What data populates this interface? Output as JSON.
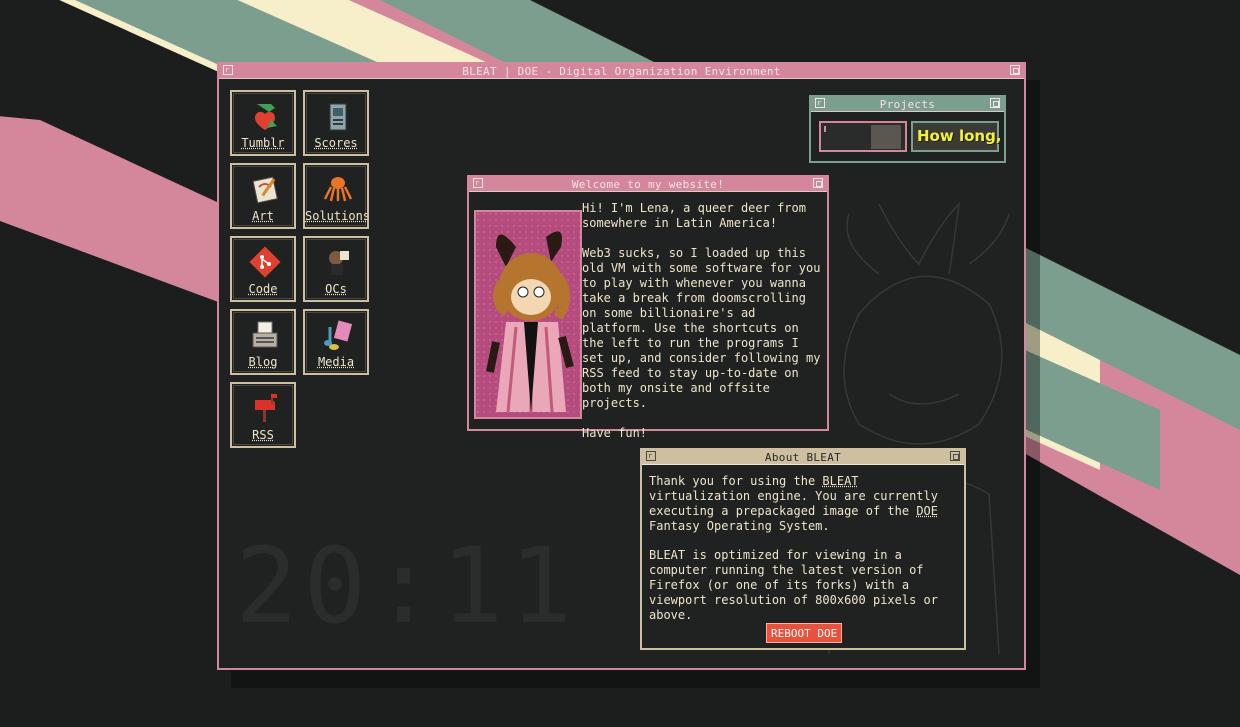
{
  "main_window": {
    "title": "BLEAT | DOE - Digital Organization Environment"
  },
  "shortcuts": [
    {
      "label": "Tumblr",
      "icon": "tumblr-icon"
    },
    {
      "label": "Scores",
      "icon": "scores-icon"
    },
    {
      "label": "Art",
      "icon": "art-icon"
    },
    {
      "label": "Solutions",
      "icon": "solutions-icon"
    },
    {
      "label": "Code",
      "icon": "code-icon"
    },
    {
      "label": "OCs",
      "icon": "ocs-icon"
    },
    {
      "label": "Blog",
      "icon": "blog-icon"
    },
    {
      "label": "Media",
      "icon": "media-icon"
    },
    {
      "label": "RSS",
      "icon": "rss-icon"
    }
  ],
  "clock": {
    "time": "20:11"
  },
  "projects": {
    "title": "Projects",
    "items": [
      {
        "name": "project-1"
      },
      {
        "name": "How long,",
        "display": "How long,"
      }
    ]
  },
  "welcome": {
    "title": "Welcome to my website!",
    "body": "Hi! I'm Lena, a queer deer from somewhere in Latin America!\n\nWeb3 sucks, so I loaded up this old VM with some software for you to play with whenever you wanna take a break from doomscrolling on some billionaire's ad platform. Use the shortcuts on the left to run the programs I set up, and consider following my RSS feed to stay up-to-date on both my onsite and offsite projects.\n\nHave fun!"
  },
  "about": {
    "title": "About BLEAT",
    "p1_a": "Thank you for using the ",
    "p1_bleat": "BLEAT",
    "p1_b": " virtualization engine. You are currently executing a prepackaged image of the ",
    "p1_doe": "DOE",
    "p1_c": " Fantasy Operating System.",
    "p2": "BLEAT is optimized for viewing in a computer running the latest version of Firefox (or one of its forks) with a viewport resolution of 800x600 pixels or above.",
    "button": "REBOOT DOE"
  },
  "colors": {
    "pink": "#d4869b",
    "teal": "#7b9e8f",
    "cream": "#f6efc9",
    "sand": "#cdbfa0",
    "bg": "#1c1e1e",
    "red": "#e8523c"
  }
}
